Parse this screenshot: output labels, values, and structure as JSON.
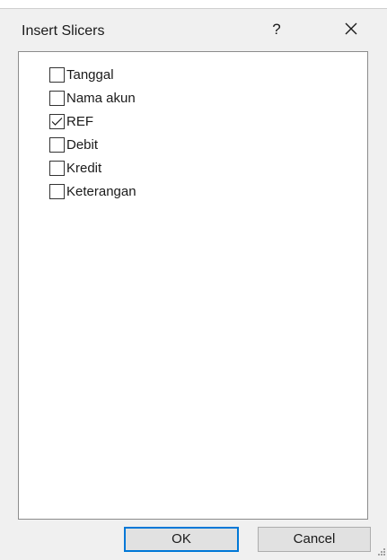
{
  "dialog": {
    "title": "Insert Slicers",
    "help_label": "?"
  },
  "fields": [
    {
      "label": "Tanggal",
      "checked": false
    },
    {
      "label": "Nama akun",
      "checked": false
    },
    {
      "label": "REF",
      "checked": true
    },
    {
      "label": "Debit",
      "checked": false
    },
    {
      "label": "Kredit",
      "checked": false
    },
    {
      "label": "Keterangan",
      "checked": false
    }
  ],
  "buttons": {
    "ok_label": "OK",
    "cancel_label": "Cancel"
  },
  "colors": {
    "accent": "#0078d7",
    "background": "#f0f0f0"
  },
  "icons": {
    "close": "close-icon",
    "check": "checkmark-icon",
    "grip": "resize-grip-icon"
  }
}
